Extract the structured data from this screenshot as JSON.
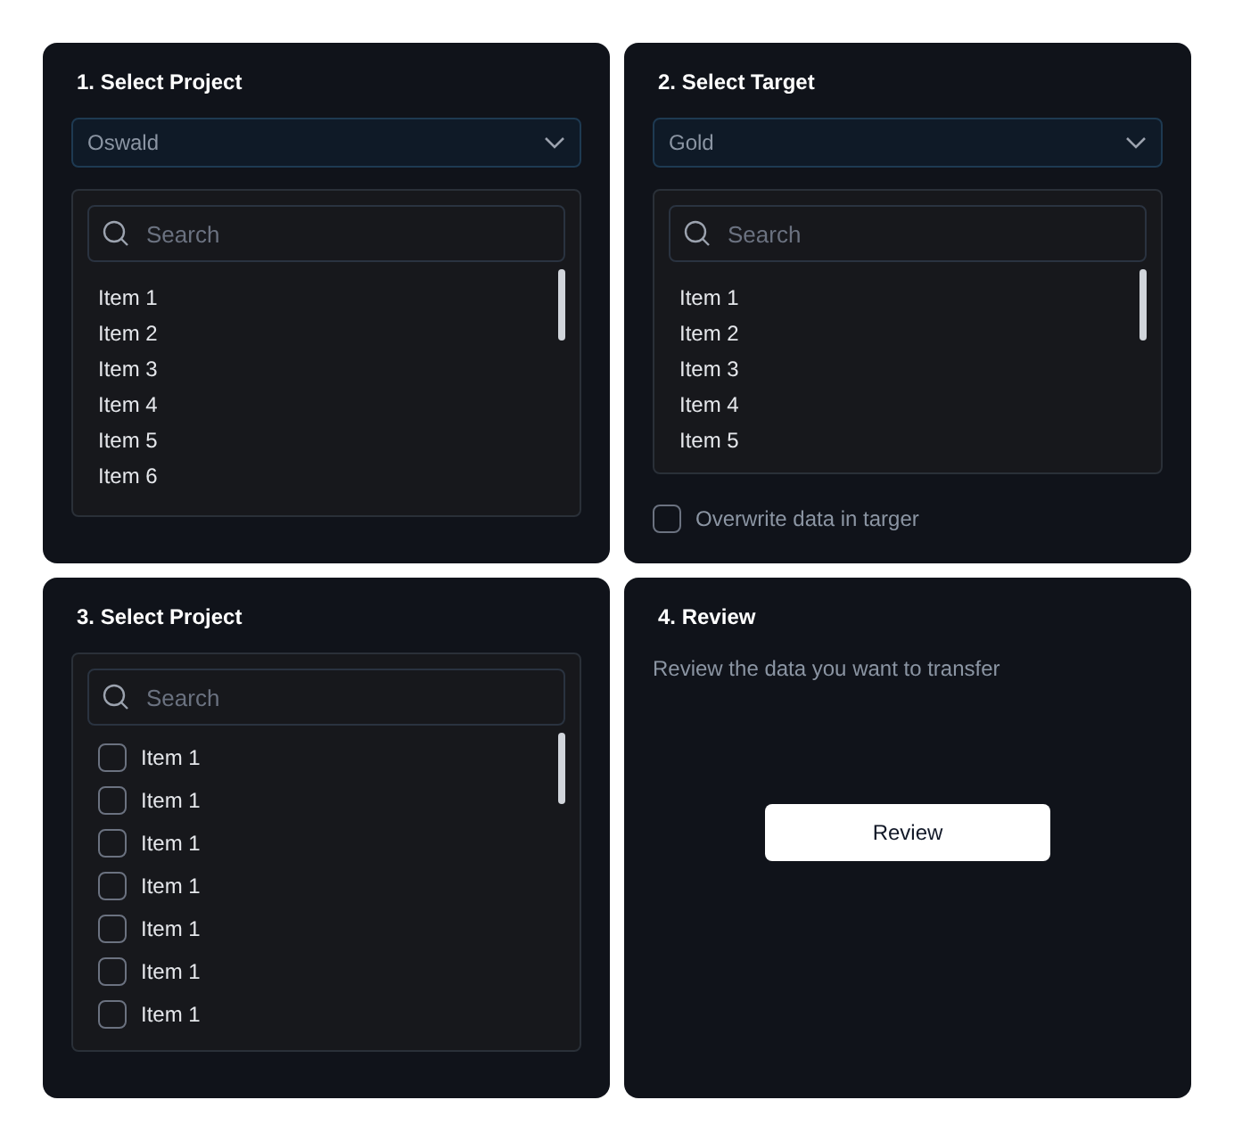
{
  "panels": [
    {
      "kind": "list",
      "title": "1. Select Project",
      "dropdown": {
        "value": "Oswald"
      },
      "search": {
        "placeholder": "Search"
      },
      "items": [
        {
          "label": "Item 1"
        },
        {
          "label": "Item 2"
        },
        {
          "label": "Item 3"
        },
        {
          "label": "Item 4"
        },
        {
          "label": "Item 5"
        },
        {
          "label": "Item 6"
        }
      ]
    },
    {
      "kind": "list",
      "title": "2. Select Target",
      "dropdown": {
        "value": "Gold"
      },
      "search": {
        "placeholder": "Search"
      },
      "items": [
        {
          "label": "Item 1"
        },
        {
          "label": "Item 2"
        },
        {
          "label": "Item 3"
        },
        {
          "label": "Item 4"
        },
        {
          "label": "Item 5"
        }
      ],
      "option": {
        "label": "Overwrite data in targer",
        "checked": false
      }
    },
    {
      "kind": "checklist",
      "title": "3. Select Project",
      "search": {
        "placeholder": "Search"
      },
      "items": [
        {
          "label": "Item 1",
          "checked": false
        },
        {
          "label": "Item 1",
          "checked": false
        },
        {
          "label": "Item 1",
          "checked": false
        },
        {
          "label": "Item 1",
          "checked": false
        },
        {
          "label": "Item 1",
          "checked": false
        },
        {
          "label": "Item 1",
          "checked": false
        },
        {
          "label": "Item 1",
          "checked": false
        }
      ]
    },
    {
      "kind": "review",
      "title": "4. Review",
      "description": "Review the data you want to transfer",
      "button": "Review"
    }
  ]
}
